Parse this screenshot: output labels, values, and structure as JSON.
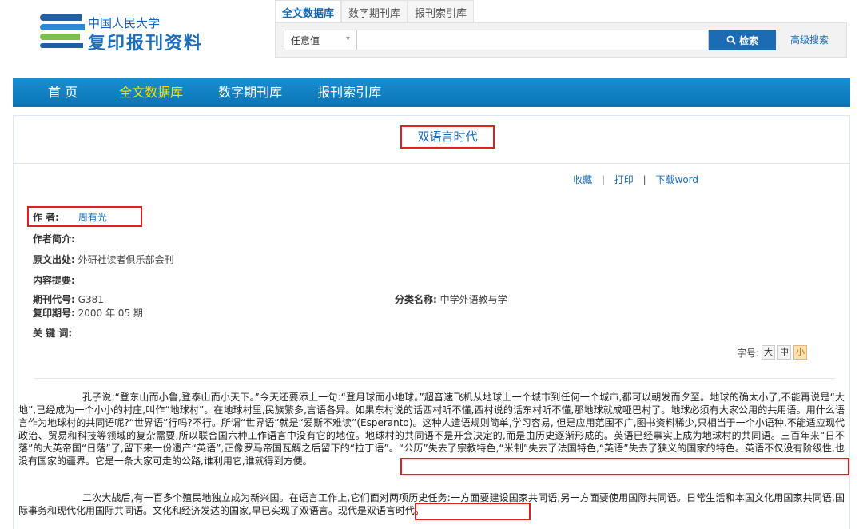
{
  "logo": {
    "subtitle": "中国人民大学",
    "name": "复印报刊资料"
  },
  "search": {
    "tabs": [
      "全文数据库",
      "数字期刊库",
      "报刊索引库"
    ],
    "active_tab": 0,
    "field_select": "任意值",
    "query": "",
    "button_label": "检索",
    "advanced_label": "高级搜索"
  },
  "nav": {
    "items": [
      "首 页",
      "全文数据库",
      "数字期刊库",
      "报刊索引库"
    ],
    "active_index": 1
  },
  "article": {
    "title": "双语言时代",
    "actions": [
      "收藏",
      "打印",
      "下载word"
    ],
    "meta": {
      "author_label": "作 者:",
      "author": "周有光",
      "author_intro_label": "作者简介:",
      "source_label": "原文出处:",
      "source": "外研社读者俱乐部会刊",
      "summary_label": "内容提要:",
      "journal_code_label": "期刊代号:",
      "journal_code": "G381",
      "category_label": "分类名称:",
      "category": "中学外语教与学",
      "reprint_label": "复印期号:",
      "reprint": "2000 年 05 期",
      "keywords_label": "关 键 词:"
    },
    "font_size_label": "字号:",
    "font_sizes": [
      "大",
      "中",
      "小"
    ],
    "active_font_size": 2,
    "paragraphs": [
      "孔子说:“登东山而小鲁,登泰山而小天下。”今天还要添上一句:“登月球而小地球。”超音速飞机从地球上一个城市到任何一个城市,都可以朝发而夕至。地球的确太小了,不能再说是“大地”,已经成为一个小小的村庄,叫作“地球村”。在地球村里,民族繁多,言语各异。如果东村说的话西村听不懂,西村说的话东村听不懂,那地球就成哑巴村了。地球必须有大家公用的共用语。用什么语言作为地球村的共同语呢?“世界语”行吗?不行。所谓“世界语”就是“爱斯不难读”(Esperanto)。这种人造语规则简单,学习容易, 但是应用范围不广,图书资料稀少,只相当于一个小语种,不能适应现代政治、贸易和科技等领域的复杂需要,所以联合国六种工作语言中没有它的地位。地球村的共同语不是开会决定的,而是由历史逐渐形成的。英语已经事实上成为地球村的共同语。三百年来“日不落”的大英帝国“日落”了,留下来一份遗产“英语”,正像罗马帝国瓦解之后留下的“拉丁语”。“公历”失去了宗教特色,“米制”失去了法国特色,“英语”失去了狭义的国家的特色。英语不仅没有阶级性,也没有国家的疆界。它是一条大家可走的公路,谁利用它,谁就得到方便。",
      "二次大战后,有一百多个殖民地独立成为新兴国。在语言工作上,它们面对两项历史任务:一方面要建设国家共同语,另一方面要使用国际共同语。日常生活和本国文化用国家共同语,国际事务和现代化用国际共同语。文化和经济发达的国家,早已实现了双语言。现代是双语言时代。"
    ]
  },
  "colors": {
    "accent": "#1b6bb5",
    "nav_active": "#f4e600",
    "highlight_box": "#e02020"
  }
}
